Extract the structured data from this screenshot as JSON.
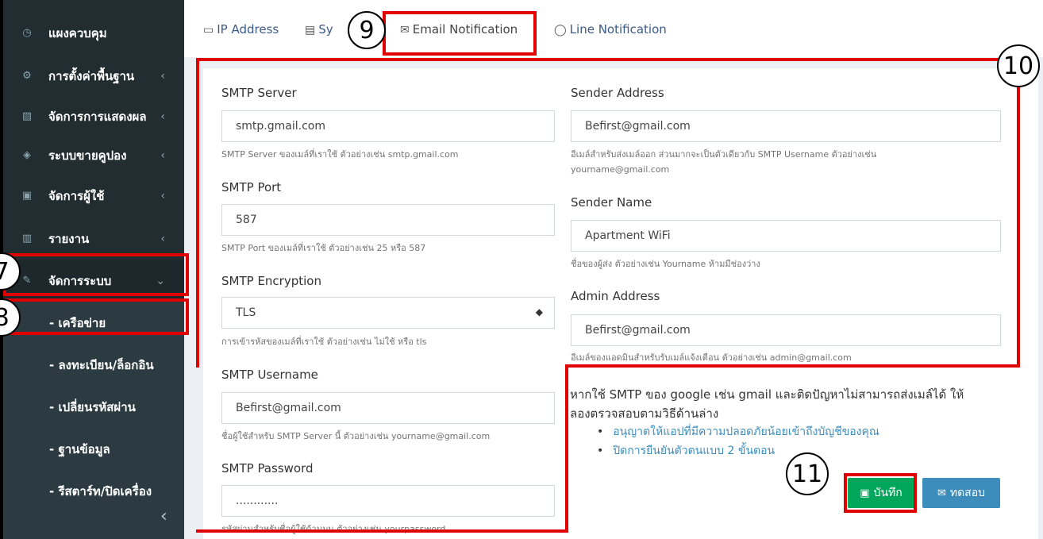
{
  "sidebar": {
    "items": [
      {
        "label": "แผงควบคุม",
        "icon": "dashboard-icon",
        "glyph": "◷"
      },
      {
        "label": "การตั้งค่าพื้นฐาน",
        "icon": "gear-icon",
        "glyph": "⚙"
      },
      {
        "label": "จัดการการแสดงผล",
        "icon": "image-icon",
        "glyph": "▨"
      },
      {
        "label": "ระบบขายคูปอง",
        "icon": "tag-icon",
        "glyph": "◈"
      },
      {
        "label": "จัดการผู้ใช้",
        "icon": "user-card-icon",
        "glyph": "▣"
      },
      {
        "label": "รายงาน",
        "icon": "bar-chart-icon",
        "glyph": "▥"
      },
      {
        "label": "จัดการระบบ",
        "icon": "wrench-icon",
        "glyph": "✎"
      }
    ],
    "sub_items": [
      {
        "label": "- เครือข่าย"
      },
      {
        "label": "- ลงทะเบียน/ล็อกอิน"
      },
      {
        "label": "- เปลี่ยนรหัสผ่าน"
      },
      {
        "label": "- ฐานข้อมูล"
      },
      {
        "label": "- รีสตาร์ท/ปิดเครื่อง"
      }
    ],
    "chevron_left": "‹",
    "chevron_down": "⌄",
    "collapse": "‹"
  },
  "tabs": [
    {
      "label": "IP Address",
      "icon": "laptop-icon",
      "glyph": "▭"
    },
    {
      "label": "Sy",
      "icon": "file-icon",
      "glyph": "▤"
    },
    {
      "label": "Email Notification",
      "icon": "envelope-icon",
      "glyph": "✉"
    },
    {
      "label": "Line Notification",
      "icon": "chat-bubble-icon",
      "glyph": "◯"
    }
  ],
  "form_left": {
    "smtp_server": {
      "label": "SMTP Server",
      "value": "smtp.gmail.com",
      "help": "SMTP Server ของเมล์ที่เราใช้ ตัวอย่างเช่น smtp.gmail.com"
    },
    "smtp_port": {
      "label": "SMTP Port",
      "value": "587",
      "help": "SMTP Port ของเมล์ที่เราใช้ ตัวอย่างเช่น 25 หรือ 587"
    },
    "smtp_encryption": {
      "label": "SMTP Encryption",
      "value": "TLS",
      "arrows": "◆",
      "help": "การเข้ารหัสของเมล์ที่เราใช้ ตัวอย่างเช่น ไม่ใช้ หรือ tls"
    },
    "smtp_username": {
      "label": "SMTP Username",
      "value": "Befirst@gmail.com",
      "help": "ชื่อผู้ใช้สำหรับ SMTP Server นี้ ตัวอย่างเช่น yourname@gmail.com"
    },
    "smtp_password": {
      "label": "SMTP Password",
      "value": "............",
      "help": "รหัสผ่านสำหรับชื่อผู้ใช้ด้านบน ตัวอย่างเช่น yourpassword"
    }
  },
  "form_right": {
    "sender_address": {
      "label": "Sender Address",
      "value": "Befirst@gmail.com",
      "help_1": "อีเมล์สำหรับส่งเมล์ออก ส่วนมากจะเป็นตัวเดียวกับ SMTP Username ตัวอย่างเช่น",
      "help_2": "yourname@gmail.com"
    },
    "sender_name": {
      "label": "Sender Name",
      "value": "Apartment WiFi",
      "help": "ชื่อของผู้ส่ง ตัวอย่างเช่น Yourname ห้ามมีช่องว่าง"
    },
    "admin_address": {
      "label": "Admin Address",
      "value": "Befirst@gmail.com",
      "help": "อีเมล์ของแอดมินสำหรับรับเมล์แจ้งเตือน ตัวอย่างเช่น admin@gmail.com"
    }
  },
  "note": {
    "line_1": "หากใช้ SMTP ของ google เช่น gmail และติดปัญหาไม่สามารถส่งเมล์ได้ ให้",
    "line_2": "ลองตรวจสอบตามวิธีด้านล่าง",
    "links": [
      "อนุญาตให้แอปที่มีความปลอดภัยน้อยเข้าถึงบัญชีของคุณ",
      "ปิดการยืนยันตัวตนแบบ 2 ขั้นตอน"
    ]
  },
  "buttons": {
    "save_label": "บันทึก",
    "save_glyph": "▣",
    "test_label": "ทดสอบ",
    "test_glyph": "✉"
  },
  "callouts": [
    "7",
    "8",
    "9",
    "10",
    "11"
  ],
  "colors": {
    "highlight": "#e00000",
    "save": "#00a65a",
    "test": "#3c8dbc",
    "sidebar": "#222d32"
  }
}
